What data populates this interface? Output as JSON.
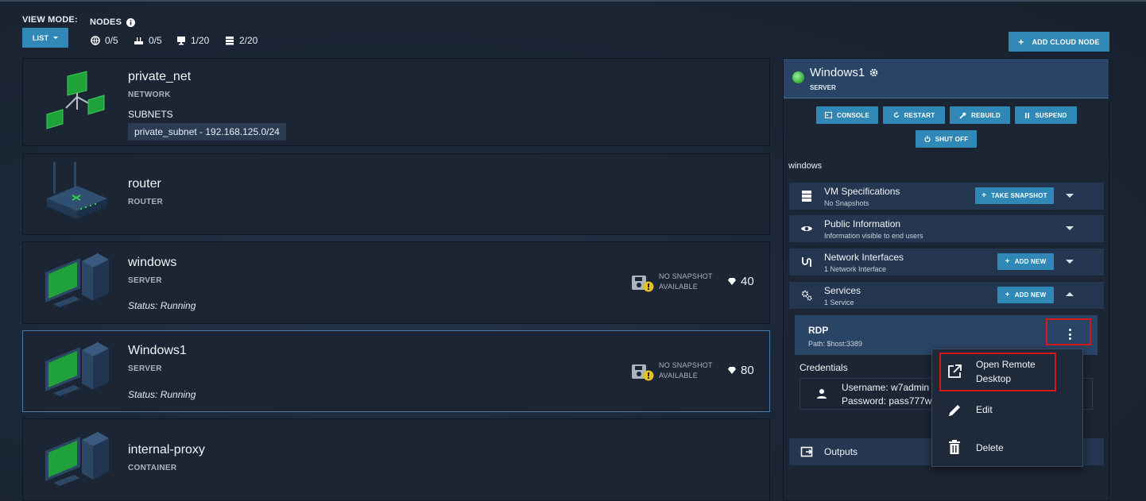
{
  "toolbar": {
    "view_mode_label": "VIEW MODE:",
    "view_mode_value": "LIST",
    "nodes_label": "NODES",
    "counts": {
      "networks": "0/5",
      "routers": "0/5",
      "servers": "1/20",
      "containers": "2/20"
    },
    "add_cloud_node": "ADD CLOUD NODE"
  },
  "nodes": [
    {
      "name": "private_net",
      "type": "NETWORK",
      "subnets_label": "SUBNETS",
      "subnet": "private_subnet - 192.168.125.0/24"
    },
    {
      "name": "router",
      "type": "ROUTER"
    },
    {
      "name": "windows",
      "type": "SERVER",
      "status": "Status: Running",
      "snapshot_line1": "NO SNAPSHOT",
      "snapshot_line2": "AVAILABLE",
      "gems": "40"
    },
    {
      "name": "Windows1",
      "type": "SERVER",
      "status": "Status: Running",
      "snapshot_line1": "NO SNAPSHOT",
      "snapshot_line2": "AVAILABLE",
      "gems": "80"
    },
    {
      "name": "internal-proxy",
      "type": "CONTAINER"
    }
  ],
  "detail": {
    "title": "Windows1",
    "type": "SERVER",
    "status_color": "#5fd35f",
    "actions": {
      "console": "CONSOLE",
      "restart": "RESTART",
      "rebuild": "REBUILD",
      "suspend": "SUSPEND",
      "shut_off": "SHUT OFF"
    },
    "os_text": "windows",
    "sections": {
      "vm_spec": {
        "title": "VM Specifications",
        "sub": "No Snapshots",
        "button": "TAKE SNAPSHOT"
      },
      "public_info": {
        "title": "Public Information",
        "sub": "Information visible to end users"
      },
      "network_if": {
        "title": "Network Interfaces",
        "sub": "1 Network Interface",
        "button": "ADD NEW"
      },
      "services": {
        "title": "Services",
        "sub": "1 Service",
        "button": "ADD NEW"
      },
      "outputs": {
        "title": "Outputs"
      }
    },
    "service": {
      "name": "RDP",
      "path": "Path: $host:3389"
    },
    "credentials": {
      "label": "Credentials",
      "username": "Username: w7admin",
      "password": "Password: pass777w"
    }
  },
  "context_menu": {
    "items": [
      "Open Remote Desktop",
      "Edit",
      "Delete"
    ],
    "open_line1": "Open Remote",
    "open_line2": "Desktop"
  },
  "colors": {
    "accent": "#2f88b5",
    "highlight": "#d11a1a",
    "screen_green": "#1fa23a"
  }
}
